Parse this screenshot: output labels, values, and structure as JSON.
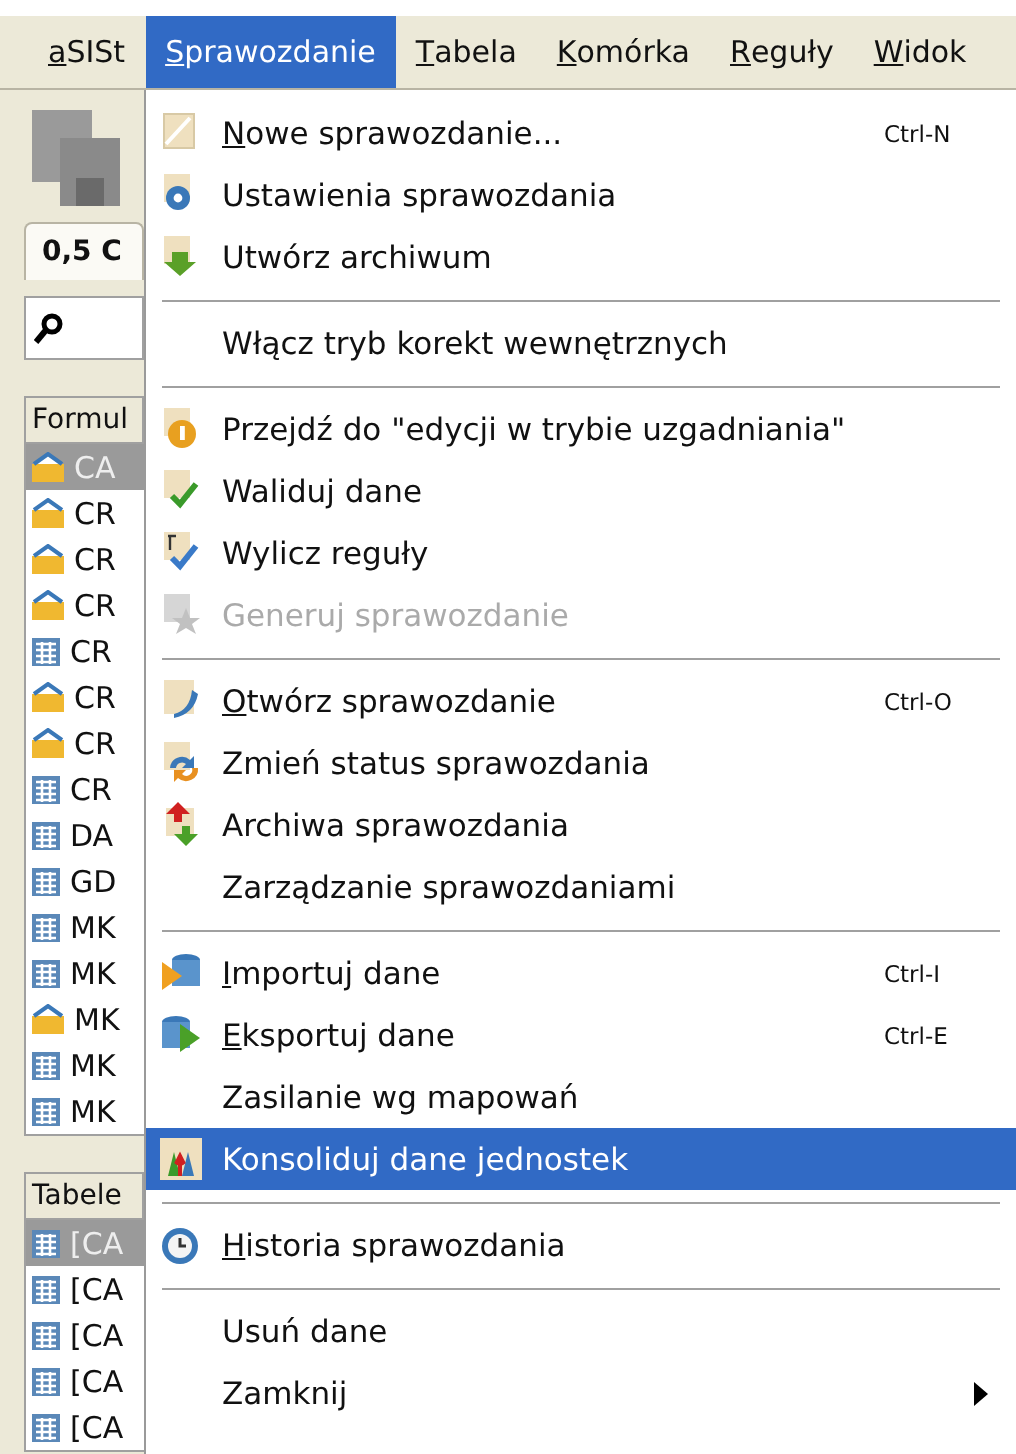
{
  "menubar": [
    {
      "label": "aSISt",
      "selected": false
    },
    {
      "label": "Sprawozdanie",
      "selected": true
    },
    {
      "label": "Tabela",
      "selected": false
    },
    {
      "label": "Komórka",
      "selected": false
    },
    {
      "label": "Reguły",
      "selected": false
    },
    {
      "label": "Widok",
      "selected": false
    }
  ],
  "left_panel": {
    "tab": {
      "label": "0,5 C",
      "selected": true
    },
    "formularze": {
      "header": "Formul",
      "rows": [
        {
          "label": "CA",
          "kind": "folder",
          "selected": true
        },
        {
          "label": "CR",
          "kind": "folder",
          "selected": false
        },
        {
          "label": "CR",
          "kind": "folder",
          "selected": false
        },
        {
          "label": "CR",
          "kind": "folder",
          "selected": false
        },
        {
          "label": "CR",
          "kind": "table",
          "selected": false
        },
        {
          "label": "CR",
          "kind": "folder",
          "selected": false
        },
        {
          "label": "CR",
          "kind": "folder",
          "selected": false
        },
        {
          "label": "CR",
          "kind": "table",
          "selected": false
        },
        {
          "label": "DA",
          "kind": "table",
          "selected": false
        },
        {
          "label": "GD",
          "kind": "table",
          "selected": false
        },
        {
          "label": "MK",
          "kind": "table",
          "selected": false
        },
        {
          "label": "MK",
          "kind": "table",
          "selected": false
        },
        {
          "label": "MK",
          "kind": "folder",
          "selected": false
        },
        {
          "label": "MK",
          "kind": "table",
          "selected": false
        },
        {
          "label": "MK",
          "kind": "table",
          "selected": false
        }
      ]
    },
    "tabele": {
      "header": "Tabele",
      "rows": [
        {
          "label": "[CA",
          "kind": "table",
          "selected": true
        },
        {
          "label": "[CA",
          "kind": "table",
          "selected": false
        },
        {
          "label": "[CA",
          "kind": "table",
          "selected": false
        },
        {
          "label": "[CA",
          "kind": "table",
          "selected": false
        },
        {
          "label": "[CA",
          "kind": "table",
          "selected": false
        }
      ]
    }
  },
  "menu": [
    {
      "kind": "item",
      "label": "Nowe sprawozdanie...",
      "shortcut": "Ctrl-N",
      "mnemonic": true,
      "disabled": false,
      "selected": false
    },
    {
      "kind": "item",
      "label": "Ustawienia sprawozdania",
      "mnemonic": false,
      "disabled": false,
      "selected": false
    },
    {
      "kind": "item",
      "label": "Utwórz archiwum",
      "mnemonic": false,
      "disabled": false,
      "selected": false
    },
    {
      "kind": "separator"
    },
    {
      "kind": "item",
      "label": "Włącz tryb korekt wewnętrznych",
      "mnemonic": false,
      "disabled": false,
      "selected": false
    },
    {
      "kind": "separator"
    },
    {
      "kind": "item",
      "label": "Przejdź do \"edycji w trybie uzgadniania\"",
      "mnemonic": false,
      "disabled": false,
      "selected": false
    },
    {
      "kind": "item",
      "label": "Waliduj dane",
      "mnemonic": false,
      "disabled": false,
      "selected": false
    },
    {
      "kind": "item",
      "label": "Wylicz reguły",
      "mnemonic": false,
      "disabled": false,
      "selected": false
    },
    {
      "kind": "item",
      "label": "Generuj sprawozdanie",
      "mnemonic": false,
      "disabled": true,
      "selected": false
    },
    {
      "kind": "separator"
    },
    {
      "kind": "item",
      "label": "Otwórz sprawozdanie",
      "shortcut": "Ctrl-O",
      "mnemonic": true,
      "disabled": false,
      "selected": false
    },
    {
      "kind": "item",
      "label": "Zmień status sprawozdania",
      "mnemonic": false,
      "disabled": false,
      "selected": false
    },
    {
      "kind": "item",
      "label": "Archiwa sprawozdania",
      "mnemonic": false,
      "disabled": false,
      "selected": false
    },
    {
      "kind": "item",
      "label": "Zarządzanie sprawozdaniami",
      "mnemonic": false,
      "disabled": false,
      "selected": false
    },
    {
      "kind": "separator"
    },
    {
      "kind": "item",
      "label": "Importuj dane",
      "shortcut": "Ctrl-I",
      "mnemonic": true,
      "disabled": false,
      "selected": false
    },
    {
      "kind": "item",
      "label": "Eksportuj dane",
      "shortcut": "Ctrl-E",
      "mnemonic": true,
      "disabled": false,
      "selected": false
    },
    {
      "kind": "item",
      "label": "Zasilanie wg mapowań",
      "mnemonic": false,
      "disabled": false,
      "selected": false
    },
    {
      "kind": "item",
      "label": "Konsoliduj dane jednostek",
      "mnemonic": false,
      "disabled": false,
      "selected": true
    },
    {
      "kind": "separator"
    },
    {
      "kind": "item",
      "label": "Historia sprawozdania",
      "mnemonic": true,
      "disabled": false,
      "selected": false
    },
    {
      "kind": "separator"
    },
    {
      "kind": "item",
      "label": "Usuń dane",
      "mnemonic": false,
      "disabled": false,
      "selected": false
    },
    {
      "kind": "item",
      "label": "Zamknij",
      "mnemonic": false,
      "disabled": false,
      "selected": false,
      "submenu": true
    }
  ]
}
